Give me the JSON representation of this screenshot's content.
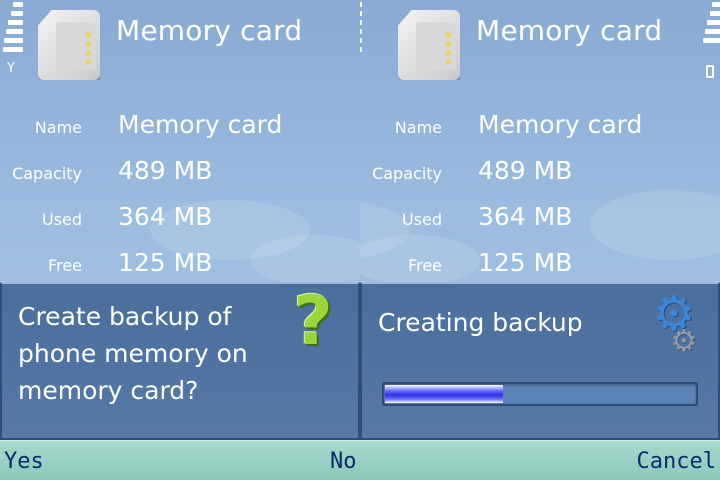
{
  "screens": [
    {
      "header": {
        "title": "Memory card",
        "icon": "memory-card-icon"
      },
      "info": [
        {
          "label": "Name",
          "value": "Memory card"
        },
        {
          "label": "Capacity",
          "value": "489 MB"
        },
        {
          "label": "Used",
          "value": "364 MB"
        },
        {
          "label": "Free",
          "value": "125 MB"
        }
      ],
      "dialog": {
        "text": "Create backup of phone memory on memory card?",
        "icon": "question-mark-icon"
      }
    },
    {
      "header": {
        "title": "Memory card",
        "icon": "memory-card-icon"
      },
      "info": [
        {
          "label": "Name",
          "value": "Memory card"
        },
        {
          "label": "Capacity",
          "value": "489 MB"
        },
        {
          "label": "Used",
          "value": "364 MB"
        },
        {
          "label": "Free",
          "value": "125 MB"
        }
      ],
      "dialog": {
        "text": "Creating backup",
        "icon": "settings-gears-icon",
        "progress": 0.38
      }
    }
  ],
  "softkeys": {
    "yes": "Yes",
    "no": "No",
    "cancel": "Cancel"
  },
  "colors": {
    "background": "#88aad3",
    "dialog": "#4a6f9d",
    "softkey_bar": "#a9d9cf",
    "softkey_text": "#0b2a6a",
    "progress": "#2f2fe0",
    "question_icon": "#9ad63a"
  }
}
